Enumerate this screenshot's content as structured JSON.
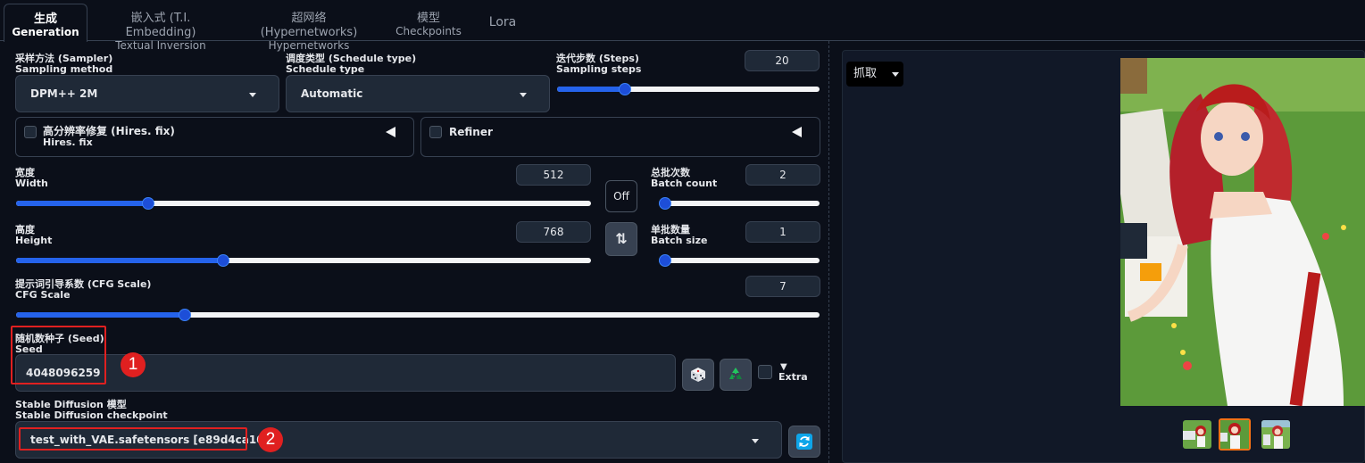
{
  "tabs": [
    {
      "label": "生成",
      "sub": "Generation",
      "active": true
    },
    {
      "label": "嵌入式 (T.I. Embedding)",
      "sub": "Textual Inversion"
    },
    {
      "label": "超网络 (Hypernetworks)",
      "sub": "Hypernetworks"
    },
    {
      "label": "模型",
      "sub": "Checkpoints"
    },
    {
      "label": "Lora"
    }
  ],
  "sampler": {
    "label_cn": "采样方法 (Sampler)",
    "label_en": "Sampling method",
    "value": "DPM++ 2M"
  },
  "schedule": {
    "label_cn": "调度类型 (Schedule type)",
    "label_en": "Schedule type",
    "value": "Automatic"
  },
  "steps": {
    "label_cn": "迭代步数 (Steps)",
    "label_en": "Sampling steps",
    "value": "20",
    "fraction": 0.26
  },
  "hires": {
    "label_cn": "高分辨率修复 (Hires. fix)",
    "label_en": "Hires. fix",
    "checked": false
  },
  "refiner": {
    "label": "Refiner",
    "checked": false
  },
  "width": {
    "label_cn": "宽度",
    "label_en": "Width",
    "value": "512",
    "fraction": 0.23
  },
  "height": {
    "label_cn": "高度",
    "label_en": "Height",
    "value": "768",
    "fraction": 0.36
  },
  "batch_count": {
    "label_cn": "总批次数",
    "label_en": "Batch count",
    "value": "2",
    "fraction": 0.0
  },
  "batch_size": {
    "label_cn": "单批数量",
    "label_en": "Batch size",
    "value": "1",
    "fraction": 0.0
  },
  "off_button": "Off",
  "swap_icon_text": "⇅",
  "cfg": {
    "label_cn": "提示词引导系数 (CFG Scale)",
    "label_en": "CFG Scale",
    "value": "7",
    "fraction": 0.21
  },
  "seed": {
    "label_cn": "随机数种子 (Seed)",
    "label_en": "Seed",
    "value": "4048096259"
  },
  "extra": {
    "label": "Extra",
    "marker": "▼"
  },
  "checkpoint": {
    "label_cn": "Stable Diffusion 模型",
    "label_en": "Stable Diffusion checkpoint",
    "value": "test_with_VAE.safetensors [e89d4ca101]"
  },
  "annotations": {
    "one": "1",
    "two": "2"
  },
  "output": {
    "grab_label": "抓取"
  },
  "colors": {
    "accent": "#2563eb",
    "annotation": "#e02020",
    "selected_thumb": "#f97316",
    "background": "#0b0f19"
  },
  "icons": [
    "dice-icon",
    "recycle-icon",
    "refresh-icon",
    "swap-icon",
    "chevron-down-icon",
    "collapse-left-icon"
  ]
}
